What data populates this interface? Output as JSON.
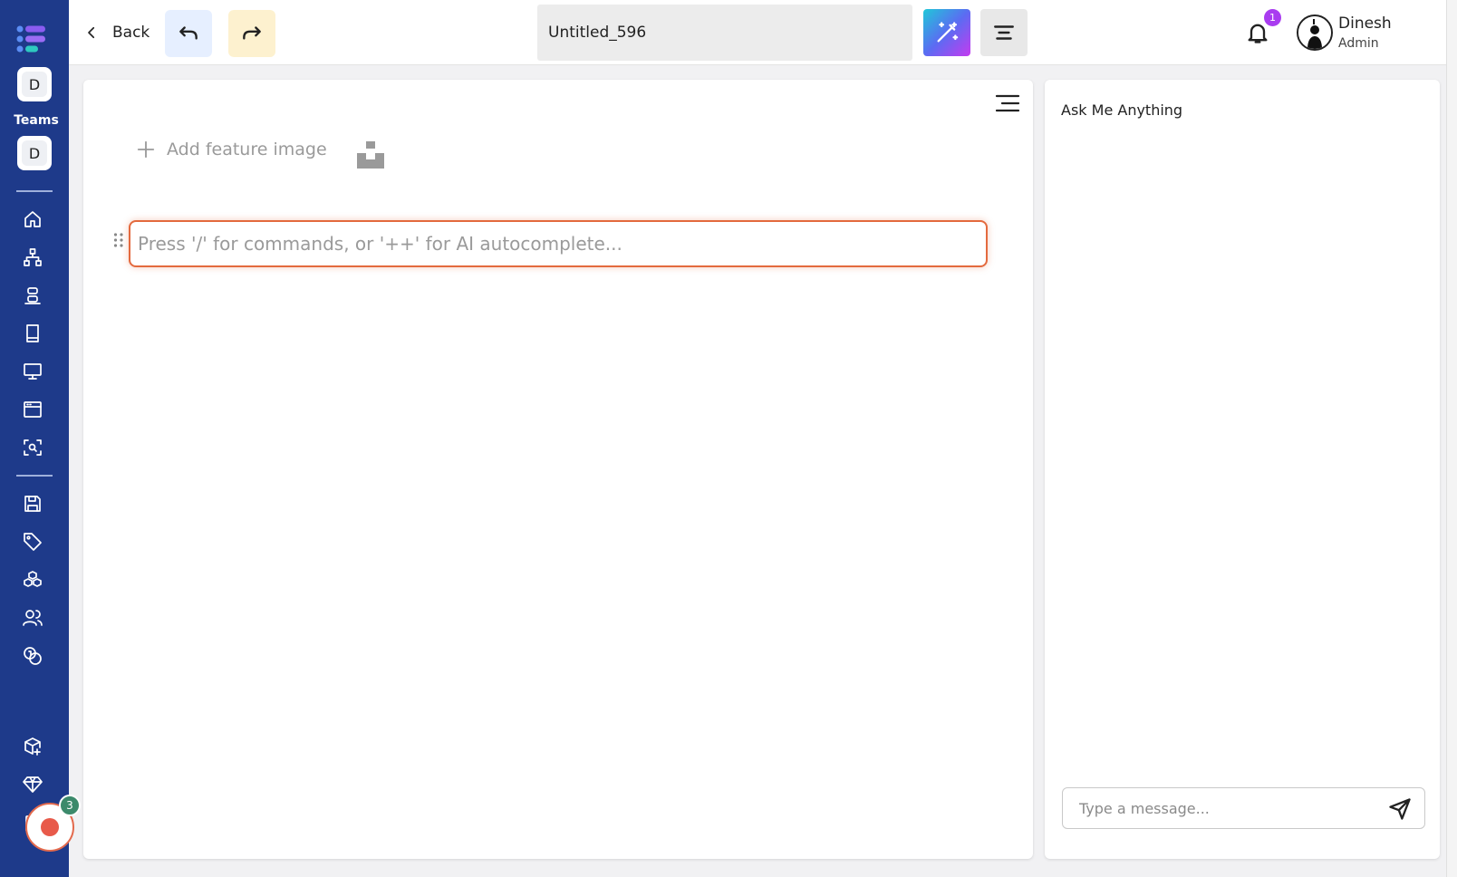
{
  "sidebar": {
    "team_initial_1": "D",
    "teams_label": "Teams",
    "team_initial_2": "D",
    "nav_icons": [
      "home-icon",
      "sitemap-icon",
      "stack-icon",
      "book-icon",
      "monitor-icon",
      "browser-window-icon",
      "scan-search-icon",
      "save-icon",
      "tag-icon",
      "cubes-icon",
      "users-icon",
      "coins-icon",
      "package-plus-icon",
      "diamond-icon",
      "clipboard-icon"
    ],
    "record_badge_count": "3"
  },
  "topbar": {
    "back_label": "Back",
    "document_title": "Untitled_596",
    "notification_count": "1",
    "user_name": "Dinesh",
    "user_role": "Admin"
  },
  "editor": {
    "add_feature_image_label": "Add feature image",
    "input_placeholder": "Press '/' for commands, or '++' for AI autocomplete..."
  },
  "chat": {
    "title": "Ask Me Anything",
    "input_placeholder": "Type a message..."
  },
  "colors": {
    "sidebar_bg": "#1e3a8a",
    "editor_focus_border": "#e36a3e",
    "notification_badge": "#a93cf0",
    "record_badge": "#3c8a6b",
    "undo_bg": "#e6efff",
    "redo_bg": "#fdf1cf"
  }
}
